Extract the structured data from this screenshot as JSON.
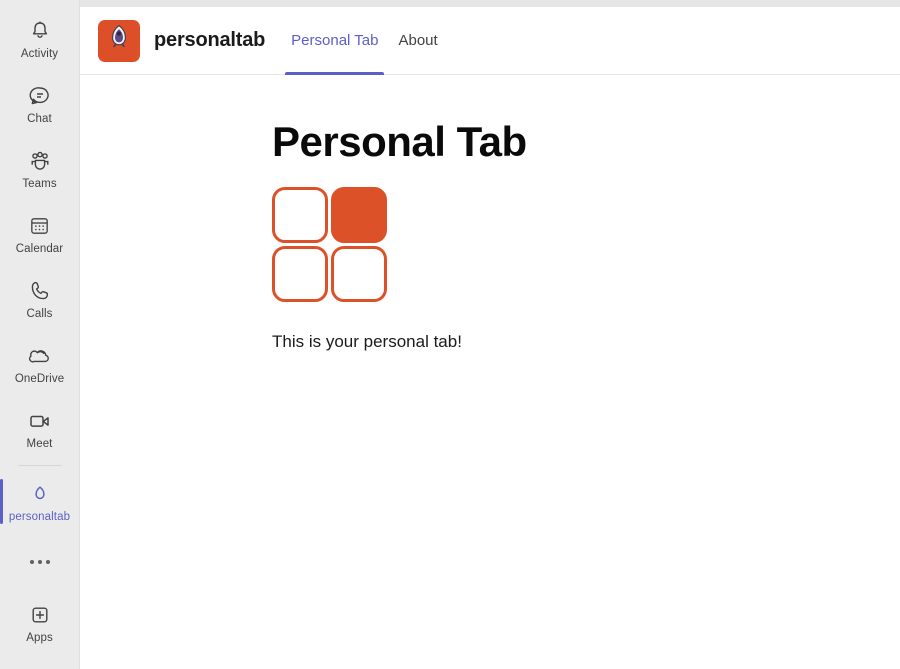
{
  "window": {
    "background": "#ffffff",
    "accent": "#5b5fc7",
    "brand_orange": "#dd5128"
  },
  "sidebar": {
    "items": [
      {
        "label": "Activity",
        "icon": "bell-icon",
        "active": false
      },
      {
        "label": "Chat",
        "icon": "chat-icon",
        "active": false
      },
      {
        "label": "Teams",
        "icon": "teams-icon",
        "active": false
      },
      {
        "label": "Calendar",
        "icon": "calendar-icon",
        "active": false
      },
      {
        "label": "Calls",
        "icon": "phone-icon",
        "active": false
      },
      {
        "label": "OneDrive",
        "icon": "onedrive-cloud-icon",
        "active": false
      },
      {
        "label": "Meet",
        "icon": "video-camera-icon",
        "active": false
      },
      {
        "label": "personaltab",
        "icon": "personaltab-rocket-icon",
        "active": true
      }
    ],
    "more": {
      "icon": "more-ellipsis-icon"
    },
    "apps": {
      "label": "Apps",
      "icon": "plus-square-icon"
    }
  },
  "appbar": {
    "logo_icon": "app-rocket-icon",
    "title": "personaltab",
    "tabs": [
      {
        "label": "Personal Tab",
        "active": true
      },
      {
        "label": "About",
        "active": false
      }
    ]
  },
  "main": {
    "heading": "Personal Tab",
    "logo": {
      "icon": "four-square-grid-icon",
      "cells": [
        {
          "filled": false
        },
        {
          "filled": true
        },
        {
          "filled": false
        },
        {
          "filled": false
        }
      ]
    },
    "body_text": "This is your personal tab!"
  }
}
